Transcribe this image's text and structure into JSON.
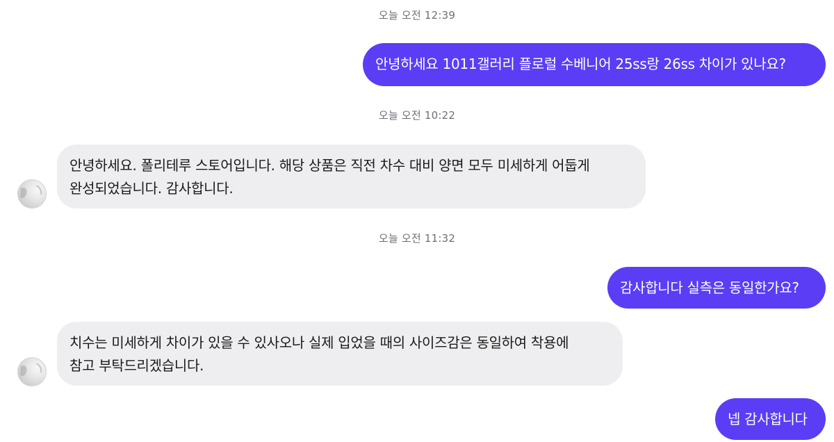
{
  "messages": [
    {
      "type": "timestamp",
      "text": "오늘 오전 12:39"
    },
    {
      "type": "outgoing",
      "text": "안녕하세요 1011갤러리 플로럴 수베니어 25ss랑 26ss 차이가 있나요?"
    },
    {
      "type": "timestamp",
      "text": "오늘 오전 10:22"
    },
    {
      "type": "incoming",
      "line1": "안녕하세요. 폴리테루 스토어입니다. 해당 상품은 직전 차수 대비 양면 모두 미세하게 어둡게",
      "line2": "완성되었습니다. 감사합니다."
    },
    {
      "type": "timestamp",
      "text": "오늘 오전 11:32"
    },
    {
      "type": "outgoing",
      "text": "감사합니다 실측은 동일한가요?"
    },
    {
      "type": "incoming",
      "line1": "치수는 미세하게 차이가 있을 수 있사오나 실제 입었을 때의 사이즈감은 동일하여 착용에",
      "line2": "참고 부탁드리겠습니다."
    },
    {
      "type": "outgoing",
      "text": "넵 감사합니다"
    }
  ],
  "colors": {
    "outgoing_bubble": "#5b3df5",
    "incoming_bubble": "#eeeef0",
    "timestamp_text": "#6e6e78"
  }
}
